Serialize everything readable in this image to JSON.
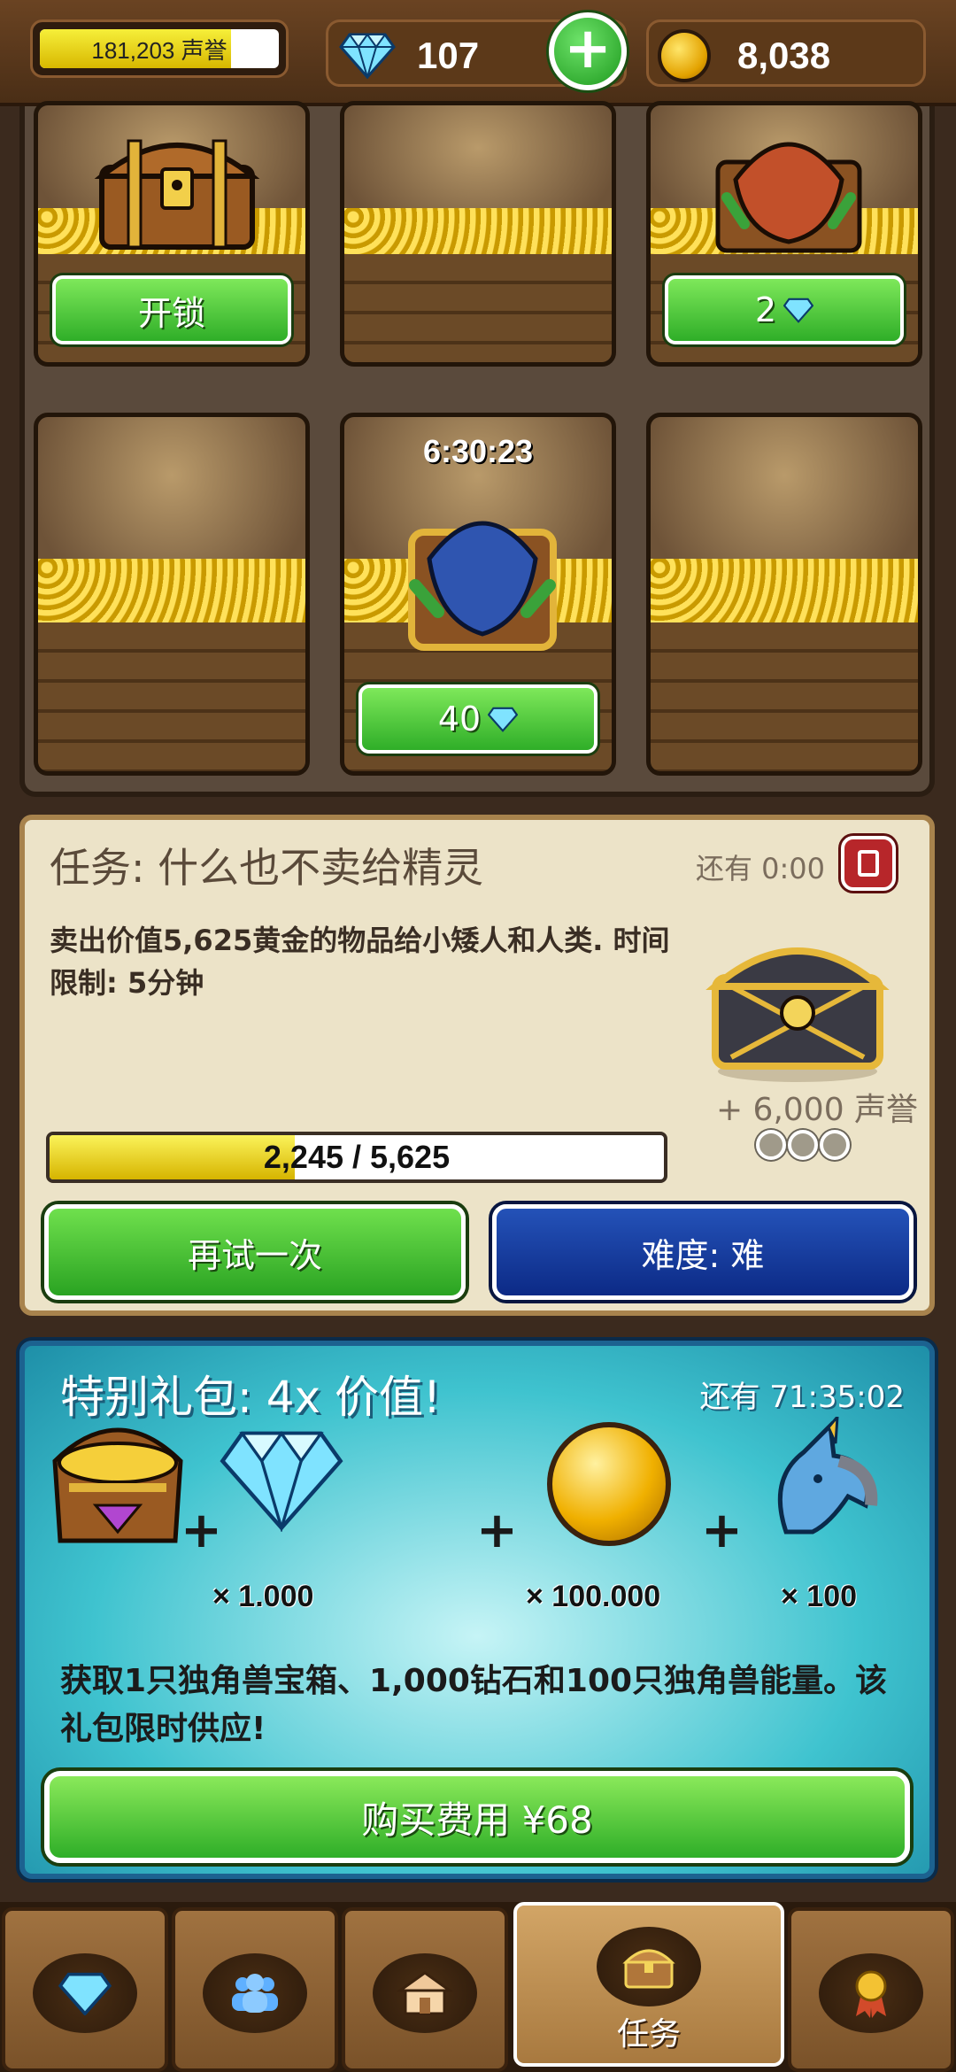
{
  "header": {
    "reputation_text": "181,203 声誉",
    "reputation_fill": 0.8,
    "gems": "107",
    "gold": "8,038"
  },
  "grid": {
    "slots": [
      {
        "state": "chest",
        "button": "开锁"
      },
      {
        "state": "empty"
      },
      {
        "state": "covered",
        "button": "2"
      },
      {
        "state": "empty"
      },
      {
        "state": "covered-timer",
        "timer": "6:30:23",
        "button": "40"
      },
      {
        "state": "empty"
      }
    ]
  },
  "quest": {
    "title": "任务: 什么也不卖给精灵",
    "time_left": "还有 0:00",
    "description": "卖出价值5,625黄金的物品给小矮人和人类. 时间限制: 5分钟",
    "reward": "+ 6,000 声誉",
    "progress_text": "2,245 / 5,625",
    "progress_current": 2245,
    "progress_total": 5625,
    "retry_label": "再试一次",
    "difficulty_label": "难度: 难"
  },
  "offer": {
    "title": "特别礼包:  4x 价值!",
    "time_left": "还有 71:35:02",
    "gem_qty": "× 1.000",
    "gold_qty": "× 100.000",
    "unicorn_qty": "× 100",
    "plus": "+",
    "description": "获取1只独角兽宝箱、1,000钻石和100只独角兽能量。该礼包限时供应!",
    "buy_label": "购买费用 ¥68"
  },
  "nav": {
    "tabs": [
      {
        "icon": "gem-icon"
      },
      {
        "icon": "people-icon"
      },
      {
        "icon": "shop-icon"
      },
      {
        "icon": "chest-icon",
        "label": "任务",
        "active": true
      },
      {
        "icon": "medal-icon"
      }
    ]
  },
  "colors": {
    "green_button": "#2fae28",
    "blue_button": "#0c2a86",
    "offer_bg": "#3fc3cf",
    "quest_bg": "#ece3c8"
  }
}
